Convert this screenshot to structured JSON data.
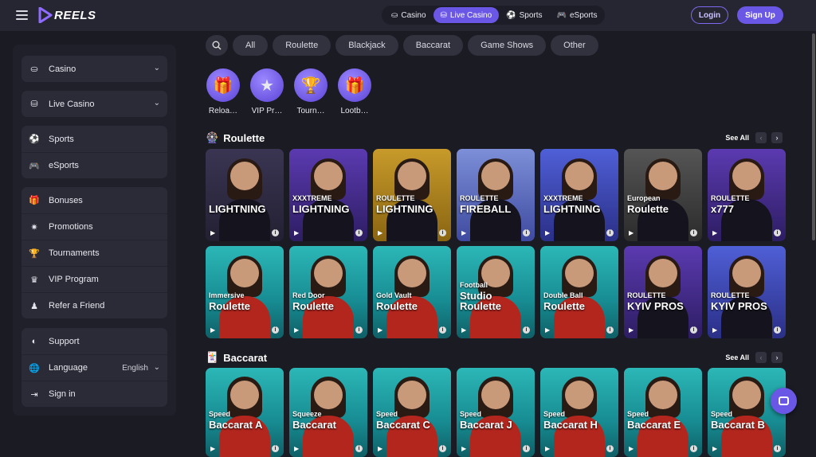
{
  "brand": {
    "name": "REELS",
    "accent": "#6b57e6"
  },
  "top_nav": {
    "tabs": [
      {
        "label": "Casino",
        "icon": "casino-icon",
        "active": false
      },
      {
        "label": "Live Casino",
        "icon": "live-casino-icon",
        "active": true
      },
      {
        "label": "Sports",
        "icon": "soccer-ball-icon",
        "active": false
      },
      {
        "label": "eSports",
        "icon": "gamepad-icon",
        "active": false
      }
    ],
    "login_label": "Login",
    "signup_label": "Sign Up"
  },
  "sidebar": {
    "group1": [
      {
        "label": "Casino",
        "icon": "casino-icon"
      }
    ],
    "group2": [
      {
        "label": "Live Casino",
        "icon": "live-casino-icon"
      }
    ],
    "group3": [
      {
        "label": "Sports",
        "icon": "soccer-ball-icon"
      },
      {
        "label": "eSports",
        "icon": "gamepad-icon"
      }
    ],
    "group4": [
      {
        "label": "Bonuses",
        "icon": "gift-icon"
      },
      {
        "label": "Promotions",
        "icon": "megaphone-icon"
      },
      {
        "label": "Tournaments",
        "icon": "trophy-icon"
      },
      {
        "label": "VIP Program",
        "icon": "crown-icon"
      },
      {
        "label": "Refer a Friend",
        "icon": "user-icon"
      }
    ],
    "group5": [
      {
        "label": "Support",
        "icon": "headset-icon"
      },
      {
        "label": "Language",
        "icon": "globe-icon",
        "value": "English"
      },
      {
        "label": "Sign in",
        "icon": "sign-in-icon"
      }
    ]
  },
  "filters": [
    "All",
    "Roulette",
    "Blackjack",
    "Baccarat",
    "Game Shows",
    "Other"
  ],
  "promos": [
    {
      "label": "Reloa…",
      "icon": "gift-icon"
    },
    {
      "label": "VIP Pr…",
      "icon": "vip-icon"
    },
    {
      "label": "Tourn…",
      "icon": "trophy-icon"
    },
    {
      "label": "Lootb…",
      "icon": "lootbox-icon"
    }
  ],
  "sections": {
    "roulette": {
      "title": "Roulette",
      "see_all": "See All",
      "prev": "‹",
      "next": "›"
    },
    "baccarat": {
      "title": "Baccarat",
      "see_all": "See All",
      "prev": "‹",
      "next": "›"
    }
  },
  "roulette_row1": [
    {
      "sub": "",
      "title": "LIGHTNING",
      "theme": "dark"
    },
    {
      "sub": "XXXTREME",
      "title": "LIGHTNING",
      "theme": "purple"
    },
    {
      "sub": "ROULETTE",
      "title": "LIGHTNING",
      "theme": "gold"
    },
    {
      "sub": "ROULETTE",
      "title": "FIREBALL",
      "theme": "lightblue"
    },
    {
      "sub": "XXXTREME",
      "title": "LIGHTNING",
      "theme": "blue"
    },
    {
      "sub": "European",
      "title": "Roulette",
      "theme": "grey"
    },
    {
      "sub": "ROULETTE",
      "title": "x777",
      "theme": "purple"
    }
  ],
  "roulette_row2": [
    {
      "sub": "Immersive",
      "title": "Roulette",
      "theme": "teal"
    },
    {
      "sub": "Red Door",
      "title": "Roulette",
      "theme": "teal"
    },
    {
      "sub": "Gold Vault",
      "title": "Roulette",
      "theme": "teal"
    },
    {
      "sub": "Football",
      "title": "Studio Roulette",
      "theme": "teal"
    },
    {
      "sub": "Double Ball",
      "title": "Roulette",
      "theme": "teal"
    },
    {
      "sub": "ROULETTE",
      "title": "KYIV PROS",
      "theme": "purple"
    },
    {
      "sub": "ROULETTE",
      "title": "KYIV PROS",
      "theme": "blue"
    }
  ],
  "baccarat_row": [
    {
      "sub": "Speed",
      "title": "Baccarat A",
      "theme": "teal"
    },
    {
      "sub": "Squeeze",
      "title": "Baccarat",
      "theme": "teal"
    },
    {
      "sub": "Speed",
      "title": "Baccarat C",
      "theme": "teal"
    },
    {
      "sub": "Speed",
      "title": "Baccarat J",
      "theme": "teal"
    },
    {
      "sub": "Speed",
      "title": "Baccarat H",
      "theme": "teal"
    },
    {
      "sub": "Speed",
      "title": "Baccarat E",
      "theme": "teal"
    },
    {
      "sub": "Speed",
      "title": "Baccarat B",
      "theme": "teal"
    }
  ]
}
